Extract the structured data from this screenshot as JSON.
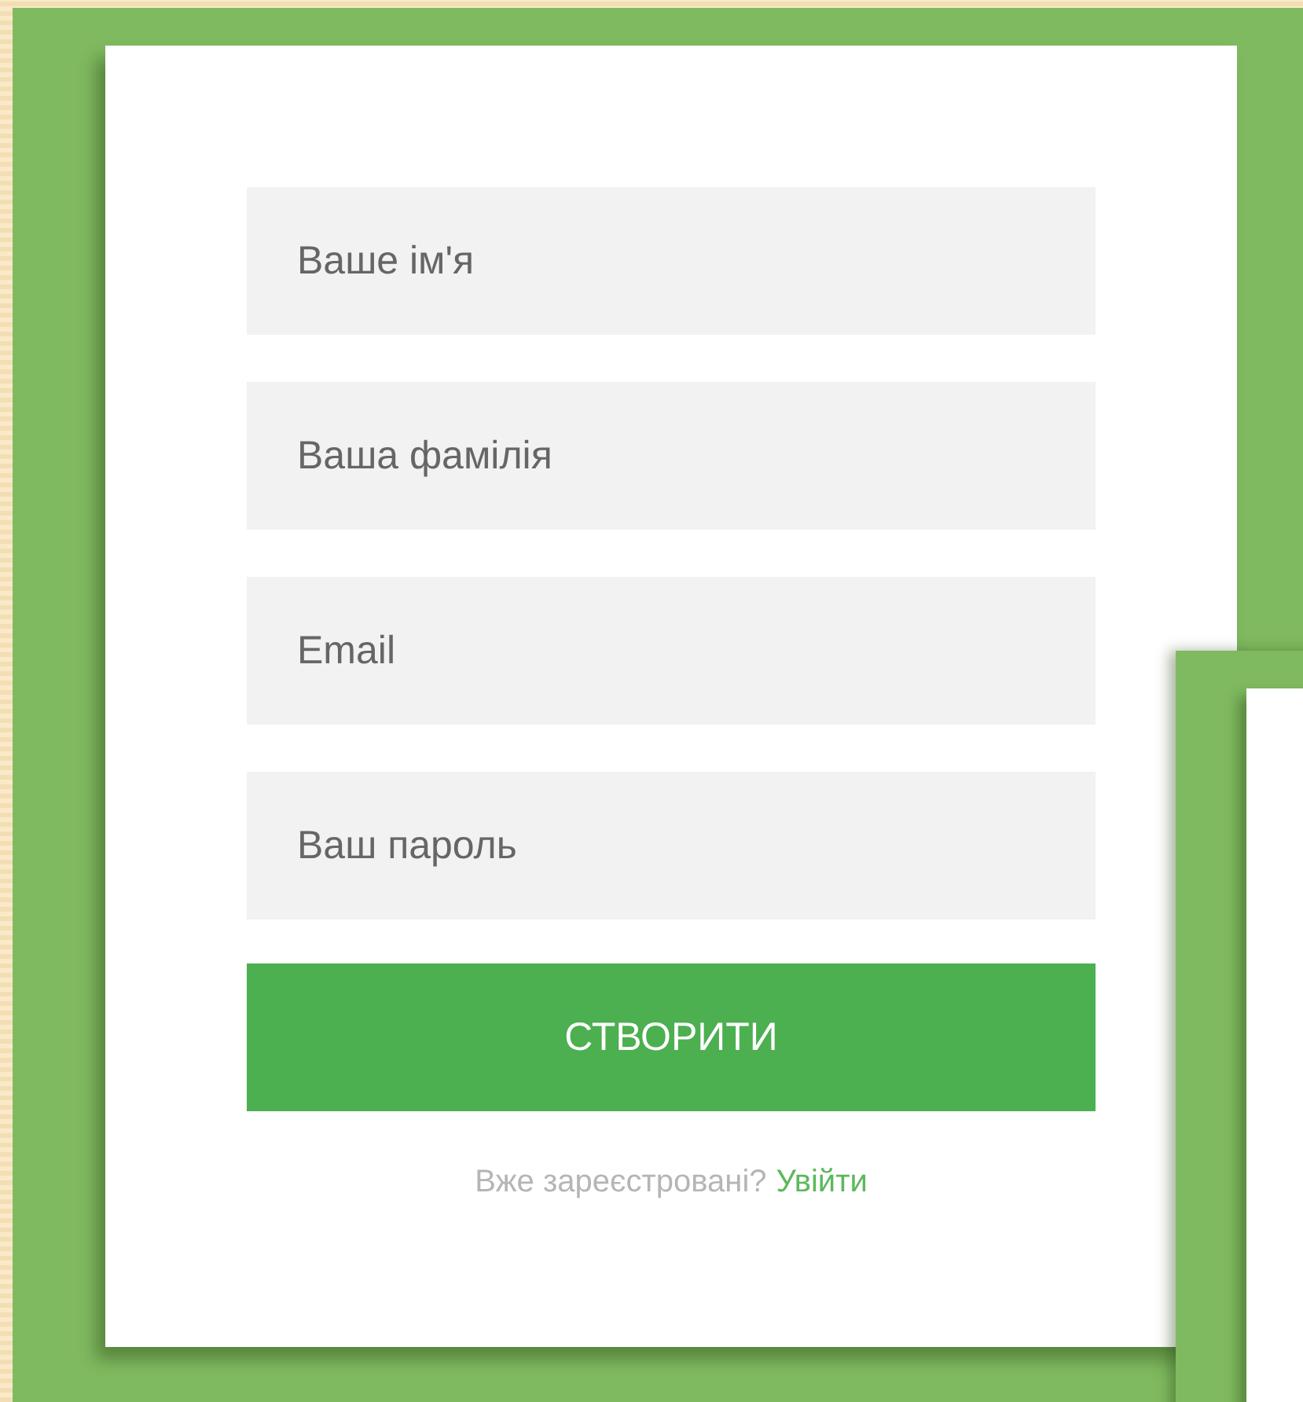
{
  "form": {
    "fields": [
      {
        "placeholder": "Ваше ім'я"
      },
      {
        "placeholder": "Ваша фамілія"
      },
      {
        "placeholder": "Email"
      },
      {
        "placeholder": "Ваш пароль"
      }
    ],
    "submit_button": "СТВОРИТИ",
    "footer": {
      "text": "Вже зареєстровані?",
      "link": "Увійти"
    }
  }
}
